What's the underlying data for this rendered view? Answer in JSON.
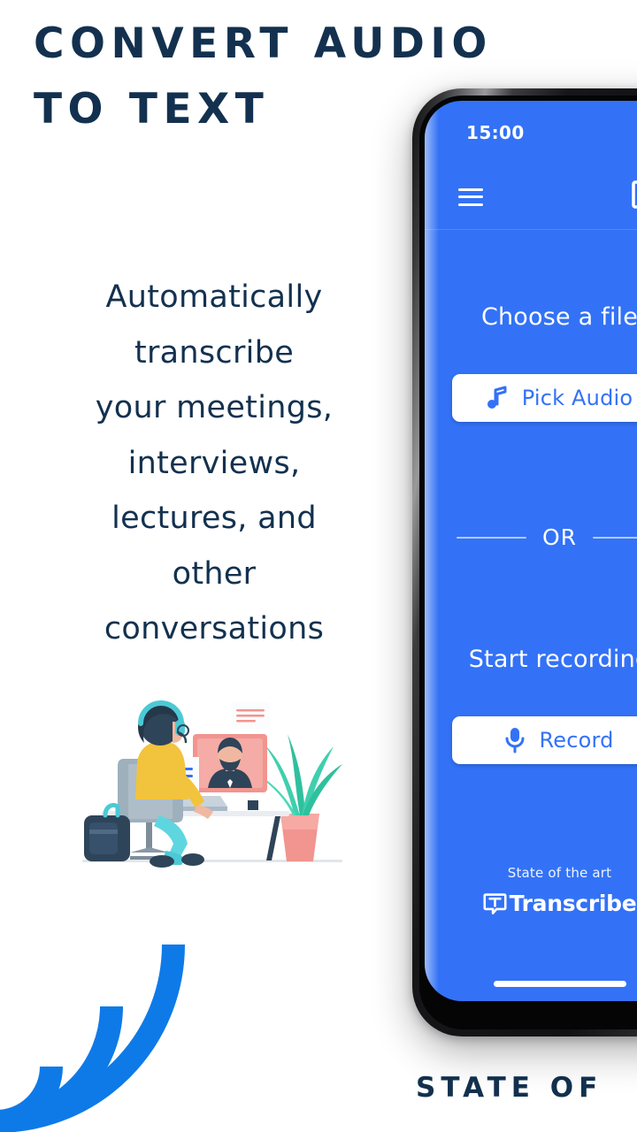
{
  "page": {
    "background_color": "#ffffff",
    "navy": "#13314f",
    "brand_blue": "#3372f6",
    "arc_blue": "#0e7ae8"
  },
  "headline": {
    "line1": "CONVERT AUDIO",
    "line2": "TO TEXT"
  },
  "subcopy": {
    "lines": [
      "Automatically",
      "transcribe",
      "your meetings,",
      "interviews,",
      "lectures, and",
      "other",
      "conversations"
    ]
  },
  "illustration": {
    "name": "person-at-desk-video-call-illustration"
  },
  "sound_waves": {
    "name": "concentric-sound-wave-arcs",
    "color": "#0e7ae8",
    "arc_count": 3
  },
  "bottom_banner": {
    "text": "STATE OF"
  },
  "phone": {
    "status_bar": {
      "time": "15:00"
    },
    "app_bar": {
      "menu_icon": "hamburger-menu-icon",
      "logo_icon": "transcribe-speech-bubble-logo"
    },
    "choose_file": {
      "title": "Choose a file",
      "button_label": "Pick Audio",
      "button_icon": "music-note-icon"
    },
    "divider": {
      "label": "OR"
    },
    "record": {
      "title": "Start recording",
      "button_label": "Record",
      "button_icon": "microphone-icon"
    },
    "footer": {
      "tagline": "State of the art",
      "brand_name": "Transcribe",
      "brand_icon": "transcribe-speech-bubble-logo"
    },
    "home_indicator": "home-indicator-pill"
  }
}
